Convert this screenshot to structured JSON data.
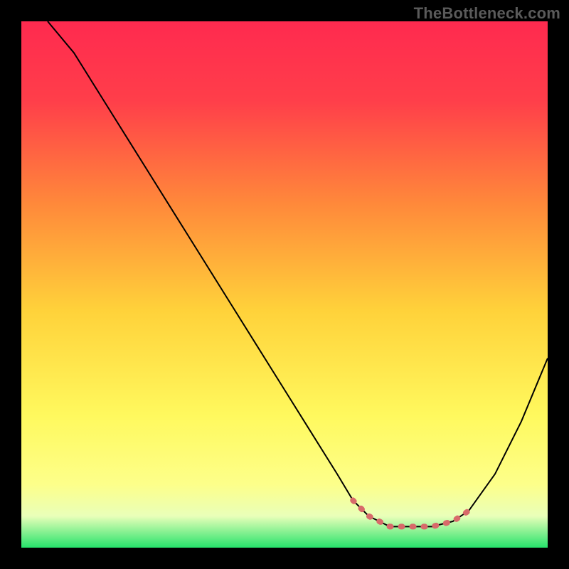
{
  "attribution": "TheBottleneck.com",
  "chart_data": {
    "type": "line",
    "title": "",
    "xlabel": "",
    "ylabel": "",
    "xlim": [
      0,
      100
    ],
    "ylim": [
      0,
      100
    ],
    "series": [
      {
        "name": "curve",
        "x": [
          5,
          10,
          15,
          20,
          25,
          30,
          35,
          40,
          45,
          50,
          55,
          60,
          63,
          66,
          70,
          74,
          78,
          82,
          85,
          90,
          95,
          100
        ],
        "y": [
          100,
          94,
          86,
          78,
          70,
          62,
          54,
          46,
          38,
          30,
          22,
          14,
          9,
          6,
          4,
          4,
          4,
          5,
          7,
          14,
          24,
          36
        ]
      },
      {
        "name": "highlight",
        "x": [
          63,
          66,
          70,
          74,
          78,
          82,
          85
        ],
        "y": [
          9,
          6,
          4,
          4,
          4,
          5,
          7
        ]
      }
    ],
    "gradient": {
      "stops": [
        {
          "offset": 0.0,
          "color": "#ff2a4f"
        },
        {
          "offset": 0.15,
          "color": "#ff3e4a"
        },
        {
          "offset": 0.35,
          "color": "#ff8a3a"
        },
        {
          "offset": 0.55,
          "color": "#ffd23a"
        },
        {
          "offset": 0.75,
          "color": "#fff95e"
        },
        {
          "offset": 0.88,
          "color": "#fdff8a"
        },
        {
          "offset": 0.94,
          "color": "#e9ffb9"
        },
        {
          "offset": 1.0,
          "color": "#26e36b"
        }
      ]
    },
    "colors": {
      "curve": "#000000",
      "highlight": "#d86a6a",
      "background": "#000000"
    }
  }
}
